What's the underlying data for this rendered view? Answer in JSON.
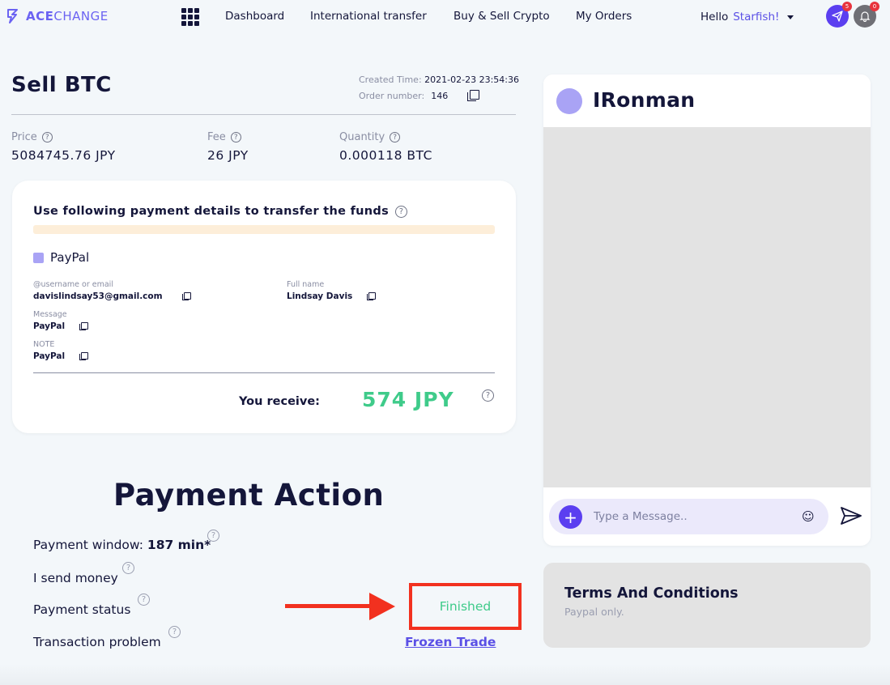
{
  "brand": {
    "name_bold": "ACE",
    "name_light": "CHANGE",
    "color": "#6b63f2"
  },
  "nav": {
    "apps_icon": "grid-icon",
    "links": [
      "Dashboard",
      "International transfer",
      "Buy & Sell Crypto",
      "My Orders"
    ],
    "greeting": "Hello",
    "username": "Starfish!",
    "send_badge": "5",
    "bell_badge": "0"
  },
  "order": {
    "title": "Sell BTC",
    "created_label": "Created Time:",
    "created_value": "2021-02-23 23:54:36",
    "order_label": "Order number:",
    "order_value": "146",
    "price_label": "Price",
    "price_value": "5084745.76 JPY",
    "fee_label": "Fee",
    "fee_value": "26 JPY",
    "quantity_label": "Quantity",
    "quantity_value": "0.000118 BTC"
  },
  "payment_card": {
    "title": "Use following payment details to transfer the funds",
    "method": "PayPal",
    "fields": [
      {
        "label": "@username or email",
        "value": "davislindsay53@gmail.com"
      },
      {
        "label": "Full name",
        "value": "Lindsay Davis"
      },
      {
        "label": "Message",
        "value": "PayPal"
      },
      {
        "label": "NOTE",
        "value": "PayPal"
      }
    ],
    "receive_label": "You receive:",
    "receive_value": "574 JPY"
  },
  "payment_action": {
    "title": "Payment Action",
    "window_label": "Payment window:",
    "window_value": "187 min*",
    "send_label": "I send money",
    "status_label": "Payment status",
    "status_value": "Finished",
    "problem_label": "Transaction problem",
    "problem_link": "Frozen Trade"
  },
  "chat": {
    "name": "IRonman",
    "placeholder": "Type a Message.."
  },
  "terms": {
    "title": "Terms And Conditions",
    "subtitle": "Paypal only."
  },
  "colors": {
    "accent": "#5b50e6",
    "success": "#3fcb8a",
    "highlight": "#f2311f",
    "text": "#14163a"
  }
}
